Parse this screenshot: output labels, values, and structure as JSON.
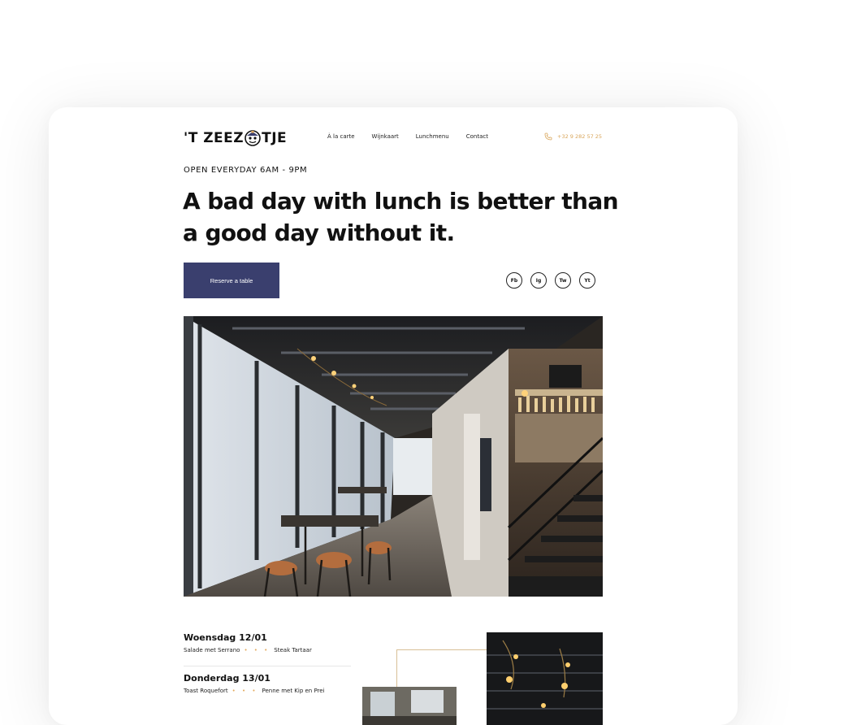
{
  "brand": {
    "name_left": "'T ZEEZ",
    "name_right": "TJE"
  },
  "nav": {
    "items": [
      "À la carte",
      "Wijnkaart",
      "Lunchmenu",
      "Contact"
    ]
  },
  "contact": {
    "phone": "+32 9 282 57 25"
  },
  "hero": {
    "hours": "OPEN EVERYDAY  6AM - 9PM",
    "headline_line1": "A bad day with lunch is better than",
    "headline_line2": "a good day without it.",
    "reserve_label": "Reserve a table"
  },
  "socials": [
    "Fb",
    "Ig",
    "Tw",
    "Yt"
  ],
  "menu": {
    "days": [
      {
        "title": "Woensdag 12/01",
        "dish1": "Salade met Serrano",
        "dish2": "Steak Tartaar"
      },
      {
        "title": "Donderdag 13/01",
        "dish1": "Toast Roquefort",
        "dish2": "Penne met Kip en Prei"
      }
    ],
    "separator": "• • •"
  },
  "colors": {
    "accent": "#3a3f6e",
    "gold": "#e3a95d",
    "phone": "#d9a65b"
  }
}
